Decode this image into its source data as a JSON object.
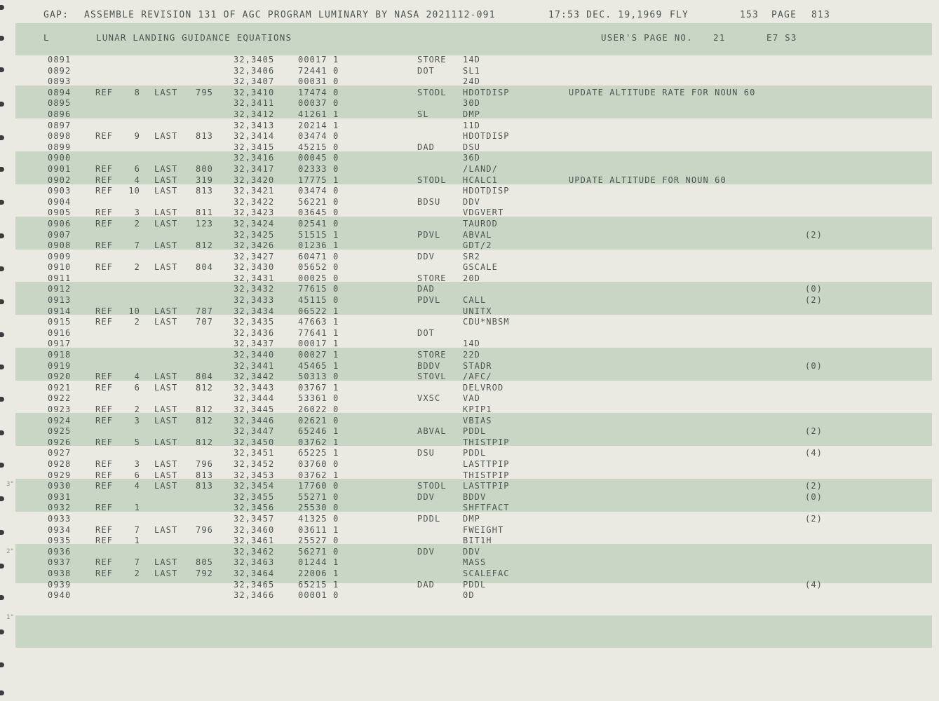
{
  "header": {
    "prefix": "GAP:",
    "text": "ASSEMBLE REVISION 131 OF AGC PROGRAM LUMINARY BY NASA 2021112-091",
    "time": "17:53 DEC. 19,1969",
    "mode": "FLY",
    "number": "153",
    "page_label": "PAGE",
    "page_num": "813"
  },
  "title": {
    "flag": "L",
    "name": "LUNAR LANDING GUIDANCE EQUATIONS",
    "users_page": "USER'S PAGE NO.",
    "users_page_num": "21",
    "code": "E7 S3"
  },
  "margin_marks": [
    "3\"",
    "2\"",
    "1\""
  ],
  "rows": [
    {
      "line": "0891",
      "ref": "",
      "refnum": "",
      "last": "",
      "lastnum": "",
      "addr": "32,3405",
      "word": "00017 1",
      "op": "STORE",
      "operand": "14D",
      "comment": "",
      "note": ""
    },
    {
      "line": "0892",
      "ref": "",
      "refnum": "",
      "last": "",
      "lastnum": "",
      "addr": "32,3406",
      "word": "72441 0",
      "op": "DOT",
      "operand": "SL1",
      "comment": "",
      "note": ""
    },
    {
      "line": "0893",
      "ref": "",
      "refnum": "",
      "last": "",
      "lastnum": "",
      "addr": "32,3407",
      "word": "00031 0",
      "op": "",
      "operand": "24D",
      "comment": "",
      "note": ""
    },
    {
      "line": "0894",
      "ref": "REF",
      "refnum": "8",
      "last": "LAST",
      "lastnum": "795",
      "addr": "32,3410",
      "word": "17474 0",
      "op": "STODL",
      "operand": "HDOTDISP",
      "comment": "UPDATE ALTITUDE RATE FOR NOUN 60",
      "note": ""
    },
    {
      "line": "0895",
      "ref": "",
      "refnum": "",
      "last": "",
      "lastnum": "",
      "addr": "32,3411",
      "word": "00037 0",
      "op": "",
      "operand": "30D",
      "comment": "",
      "note": ""
    },
    {
      "line": "0896",
      "ref": "",
      "refnum": "",
      "last": "",
      "lastnum": "",
      "addr": "32,3412",
      "word": "41261 1",
      "op": "SL",
      "operand": "DMP",
      "comment": "",
      "note": ""
    },
    {
      "line": "0897",
      "ref": "",
      "refnum": "",
      "last": "",
      "lastnum": "",
      "addr": "32,3413",
      "word": "20214 1",
      "op": "",
      "operand": "11D",
      "comment": "",
      "note": ""
    },
    {
      "line": "0898",
      "ref": "REF",
      "refnum": "9",
      "last": "LAST",
      "lastnum": "813",
      "addr": "32,3414",
      "word": "03474 0",
      "op": "",
      "operand": "HDOTDISP",
      "comment": "",
      "note": ""
    },
    {
      "line": "0899",
      "ref": "",
      "refnum": "",
      "last": "",
      "lastnum": "",
      "addr": "32,3415",
      "word": "45215 0",
      "op": "DAD",
      "operand": "DSU",
      "comment": "",
      "note": ""
    },
    {
      "line": "0900",
      "ref": "",
      "refnum": "",
      "last": "",
      "lastnum": "",
      "addr": "32,3416",
      "word": "00045 0",
      "op": "",
      "operand": "36D",
      "comment": "",
      "note": ""
    },
    {
      "line": "0901",
      "ref": "REF",
      "refnum": "6",
      "last": "LAST",
      "lastnum": "800",
      "addr": "32,3417",
      "word": "02333 0",
      "op": "",
      "operand": "/LAND/",
      "comment": "",
      "note": ""
    },
    {
      "line": "0902",
      "ref": "REF",
      "refnum": "4",
      "last": "LAST",
      "lastnum": "319",
      "addr": "32,3420",
      "word": "17775 1",
      "op": "STODL",
      "operand": "HCALC1",
      "comment": "UPDATE ALTITUDE FOR NOUN 60",
      "note": ""
    },
    {
      "line": "0903",
      "ref": "REF",
      "refnum": "10",
      "last": "LAST",
      "lastnum": "813",
      "addr": "32,3421",
      "word": "03474 0",
      "op": "",
      "operand": "HDOTDISP",
      "comment": "",
      "note": ""
    },
    {
      "line": "0904",
      "ref": "",
      "refnum": "",
      "last": "",
      "lastnum": "",
      "addr": "32,3422",
      "word": "56221 0",
      "op": "BDSU",
      "operand": "DDV",
      "comment": "",
      "note": ""
    },
    {
      "line": "0905",
      "ref": "REF",
      "refnum": "3",
      "last": "LAST",
      "lastnum": "811",
      "addr": "32,3423",
      "word": "03645 0",
      "op": "",
      "operand": "VDGVERT",
      "comment": "",
      "note": ""
    },
    {
      "line": "0906",
      "ref": "REF",
      "refnum": "2",
      "last": "LAST",
      "lastnum": "123",
      "addr": "32,3424",
      "word": "02541 0",
      "op": "",
      "operand": "TAUROD",
      "comment": "",
      "note": ""
    },
    {
      "line": "0907",
      "ref": "",
      "refnum": "",
      "last": "",
      "lastnum": "",
      "addr": "32,3425",
      "word": "51515 1",
      "op": "PDVL",
      "operand": "ABVAL",
      "comment": "",
      "note": "(2)"
    },
    {
      "line": "0908",
      "ref": "REF",
      "refnum": "7",
      "last": "LAST",
      "lastnum": "812",
      "addr": "32,3426",
      "word": "01236 1",
      "op": "",
      "operand": "GDT/2",
      "comment": "",
      "note": ""
    },
    {
      "line": "0909",
      "ref": "",
      "refnum": "",
      "last": "",
      "lastnum": "",
      "addr": "32,3427",
      "word": "60471 0",
      "op": "DDV",
      "operand": "SR2",
      "comment": "",
      "note": ""
    },
    {
      "line": "0910",
      "ref": "REF",
      "refnum": "2",
      "last": "LAST",
      "lastnum": "804",
      "addr": "32,3430",
      "word": "05652 0",
      "op": "",
      "operand": "GSCALE",
      "comment": "",
      "note": ""
    },
    {
      "line": "0911",
      "ref": "",
      "refnum": "",
      "last": "",
      "lastnum": "",
      "addr": "32,3431",
      "word": "00025 0",
      "op": "STORE",
      "operand": "20D",
      "comment": "",
      "note": ""
    },
    {
      "line": "0912",
      "ref": "",
      "refnum": "",
      "last": "",
      "lastnum": "",
      "addr": "32,3432",
      "word": "77615 0",
      "op": "DAD",
      "operand": "",
      "comment": "",
      "note": "(0)"
    },
    {
      "line": "0913",
      "ref": "",
      "refnum": "",
      "last": "",
      "lastnum": "",
      "addr": "32,3433",
      "word": "45115 0",
      "op": "PDVL",
      "operand": "CALL",
      "comment": "",
      "note": "(2)"
    },
    {
      "line": "0914",
      "ref": "REF",
      "refnum": "10",
      "last": "LAST",
      "lastnum": "787",
      "addr": "32,3434",
      "word": "06522 1",
      "op": "",
      "operand": "UNITX",
      "comment": "",
      "note": ""
    },
    {
      "line": "0915",
      "ref": "REF",
      "refnum": "2",
      "last": "LAST",
      "lastnum": "707",
      "addr": "32,3435",
      "word": "47663 1",
      "op": "",
      "operand": "CDU*NBSM",
      "comment": "",
      "note": ""
    },
    {
      "line": "0916",
      "ref": "",
      "refnum": "",
      "last": "",
      "lastnum": "",
      "addr": "32,3436",
      "word": "77641 1",
      "op": "DOT",
      "operand": "",
      "comment": "",
      "note": ""
    },
    {
      "line": "0917",
      "ref": "",
      "refnum": "",
      "last": "",
      "lastnum": "",
      "addr": "32,3437",
      "word": "00017 1",
      "op": "",
      "operand": "14D",
      "comment": "",
      "note": ""
    },
    {
      "line": "0918",
      "ref": "",
      "refnum": "",
      "last": "",
      "lastnum": "",
      "addr": "32,3440",
      "word": "00027 1",
      "op": "STORE",
      "operand": "22D",
      "comment": "",
      "note": ""
    },
    {
      "line": "0919",
      "ref": "",
      "refnum": "",
      "last": "",
      "lastnum": "",
      "addr": "32,3441",
      "word": "45465 1",
      "op": "BDDV",
      "operand": "STADR",
      "comment": "",
      "note": "(0)"
    },
    {
      "line": "0920",
      "ref": "REF",
      "refnum": "4",
      "last": "LAST",
      "lastnum": "804",
      "addr": "32,3442",
      "word": "50313 0",
      "op": "STOVL",
      "operand": "/AFC/",
      "comment": "",
      "note": ""
    },
    {
      "line": "0921",
      "ref": "REF",
      "refnum": "6",
      "last": "LAST",
      "lastnum": "812",
      "addr": "32,3443",
      "word": "03767 1",
      "op": "",
      "operand": "DELVROD",
      "comment": "",
      "note": ""
    },
    {
      "line": "0922",
      "ref": "",
      "refnum": "",
      "last": "",
      "lastnum": "",
      "addr": "32,3444",
      "word": "53361 0",
      "op": "VXSC",
      "operand": "VAD",
      "comment": "",
      "note": ""
    },
    {
      "line": "0923",
      "ref": "REF",
      "refnum": "2",
      "last": "LAST",
      "lastnum": "812",
      "addr": "32,3445",
      "word": "26022 0",
      "op": "",
      "operand": "KPIP1",
      "comment": "",
      "note": ""
    },
    {
      "line": "0924",
      "ref": "REF",
      "refnum": "3",
      "last": "LAST",
      "lastnum": "812",
      "addr": "32,3446",
      "word": "02621 0",
      "op": "",
      "operand": "VBIAS",
      "comment": "",
      "note": ""
    },
    {
      "line": "0925",
      "ref": "",
      "refnum": "",
      "last": "",
      "lastnum": "",
      "addr": "32,3447",
      "word": "65246 1",
      "op": "ABVAL",
      "operand": "PDDL",
      "comment": "",
      "note": "(2)"
    },
    {
      "line": "0926",
      "ref": "REF",
      "refnum": "5",
      "last": "LAST",
      "lastnum": "812",
      "addr": "32,3450",
      "word": "03762 1",
      "op": "",
      "operand": "THISTPIP",
      "comment": "",
      "note": ""
    },
    {
      "line": "0927",
      "ref": "",
      "refnum": "",
      "last": "",
      "lastnum": "",
      "addr": "32,3451",
      "word": "65225 1",
      "op": "DSU",
      "operand": "PDDL",
      "comment": "",
      "note": "(4)"
    },
    {
      "line": "0928",
      "ref": "REF",
      "refnum": "3",
      "last": "LAST",
      "lastnum": "796",
      "addr": "32,3452",
      "word": "03760 0",
      "op": "",
      "operand": "LASTTPIP",
      "comment": "",
      "note": ""
    },
    {
      "line": "0929",
      "ref": "REF",
      "refnum": "6",
      "last": "LAST",
      "lastnum": "813",
      "addr": "32,3453",
      "word": "03762 1",
      "op": "",
      "operand": "THISTPIP",
      "comment": "",
      "note": ""
    },
    {
      "line": "0930",
      "ref": "REF",
      "refnum": "4",
      "last": "LAST",
      "lastnum": "813",
      "addr": "32,3454",
      "word": "17760 0",
      "op": "STODL",
      "operand": "LASTTPIP",
      "comment": "",
      "note": "(2)"
    },
    {
      "line": "0931",
      "ref": "",
      "refnum": "",
      "last": "",
      "lastnum": "",
      "addr": "32,3455",
      "word": "55271 0",
      "op": "DDV",
      "operand": "BDDV",
      "comment": "",
      "note": "(0)"
    },
    {
      "line": "0932",
      "ref": "REF",
      "refnum": "1",
      "last": "",
      "lastnum": "",
      "addr": "32,3456",
      "word": "25530 0",
      "op": "",
      "operand": "SHFTFACT",
      "comment": "",
      "note": ""
    },
    {
      "line": "0933",
      "ref": "",
      "refnum": "",
      "last": "",
      "lastnum": "",
      "addr": "32,3457",
      "word": "41325 0",
      "op": "PDDL",
      "operand": "DMP",
      "comment": "",
      "note": "(2)"
    },
    {
      "line": "0934",
      "ref": "REF",
      "refnum": "7",
      "last": "LAST",
      "lastnum": "796",
      "addr": "32,3460",
      "word": "03611 1",
      "op": "",
      "operand": "FWEIGHT",
      "comment": "",
      "note": ""
    },
    {
      "line": "0935",
      "ref": "REF",
      "refnum": "1",
      "last": "",
      "lastnum": "",
      "addr": "32,3461",
      "word": "25527 0",
      "op": "",
      "operand": "BIT1H",
      "comment": "",
      "note": ""
    },
    {
      "line": "0936",
      "ref": "",
      "refnum": "",
      "last": "",
      "lastnum": "",
      "addr": "32,3462",
      "word": "56271 0",
      "op": "DDV",
      "operand": "DDV",
      "comment": "",
      "note": ""
    },
    {
      "line": "0937",
      "ref": "REF",
      "refnum": "7",
      "last": "LAST",
      "lastnum": "805",
      "addr": "32,3463",
      "word": "01244 1",
      "op": "",
      "operand": "MASS",
      "comment": "",
      "note": ""
    },
    {
      "line": "0938",
      "ref": "REF",
      "refnum": "2",
      "last": "LAST",
      "lastnum": "792",
      "addr": "32,3464",
      "word": "22006 1",
      "op": "",
      "operand": "SCALEFAC",
      "comment": "",
      "note": ""
    },
    {
      "line": "0939",
      "ref": "",
      "refnum": "",
      "last": "",
      "lastnum": "",
      "addr": "32,3465",
      "word": "65215 1",
      "op": "DAD",
      "operand": "PDDL",
      "comment": "",
      "note": "(4)"
    },
    {
      "line": "0940",
      "ref": "",
      "refnum": "",
      "last": "",
      "lastnum": "",
      "addr": "32,3466",
      "word": "00001 0",
      "op": "",
      "operand": "0D",
      "comment": "",
      "note": ""
    }
  ]
}
